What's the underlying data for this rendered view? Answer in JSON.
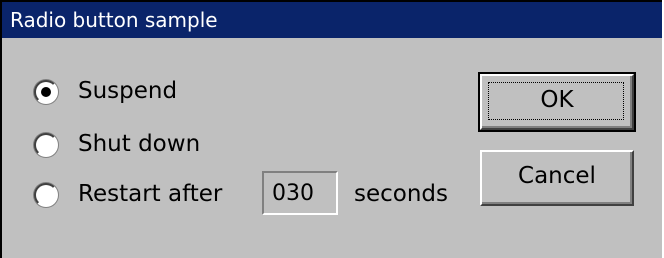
{
  "window": {
    "title": "Radio button sample"
  },
  "options": [
    {
      "label": "Suspend",
      "selected": true
    },
    {
      "label": "Shut down",
      "selected": false
    },
    {
      "label": "Restart after",
      "selected": false
    }
  ],
  "restart": {
    "value": "030",
    "unit_label": "seconds"
  },
  "buttons": {
    "ok_label": "OK",
    "cancel_label": "Cancel"
  },
  "colors": {
    "title_bar": "#0a246a",
    "dialog_face": "#c0c0c0"
  }
}
